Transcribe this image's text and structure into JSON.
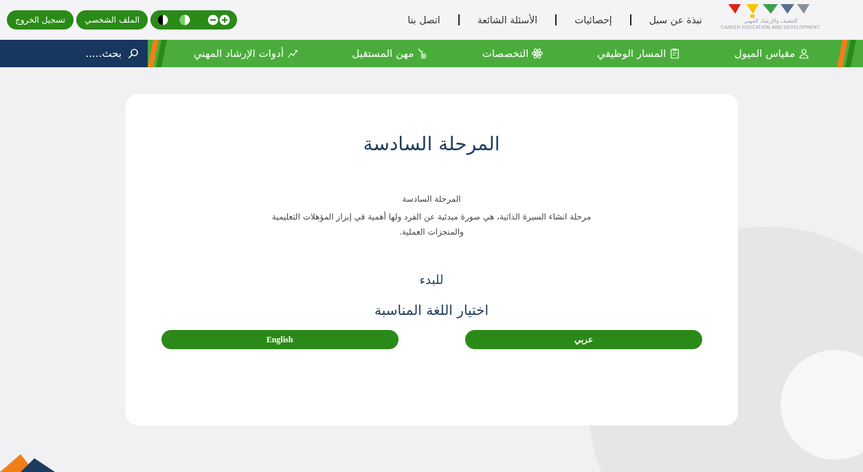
{
  "logo": {
    "arabic": "التثقيف والإرشاد المهني",
    "english": "CAREER EDUCATION AND DEVELOPMENT"
  },
  "top_links": [
    "نبذة عن سبل",
    "إحصائيات",
    "الأسئلة الشائعة",
    "اتصل بنا"
  ],
  "account_buttons": [
    "الملف الشخصي",
    "تسجيل الخروج"
  ],
  "nav": [
    {
      "label": "مقياس الميول"
    },
    {
      "label": "المسار الوظيفي"
    },
    {
      "label": "التخصصات"
    },
    {
      "label": "مهن المستقبل"
    },
    {
      "label": "أدوات الإرشاد المهني"
    }
  ],
  "search": {
    "placeholder": "بحث....."
  },
  "card": {
    "title": "المرحلة السادسة",
    "subtitle": "المرحلة السادسة",
    "description": "مرحلة انشاء السيرة الذاتية، هي صورة مبدئية عن الفرد ولها أهمية في إبراز المؤهلات التعليمية والمنجزات العملية.",
    "start": "للبدء",
    "choose": "اختيار اللغة المناسبة",
    "languages": [
      {
        "label": "عربي"
      },
      {
        "label": "English"
      }
    ]
  }
}
